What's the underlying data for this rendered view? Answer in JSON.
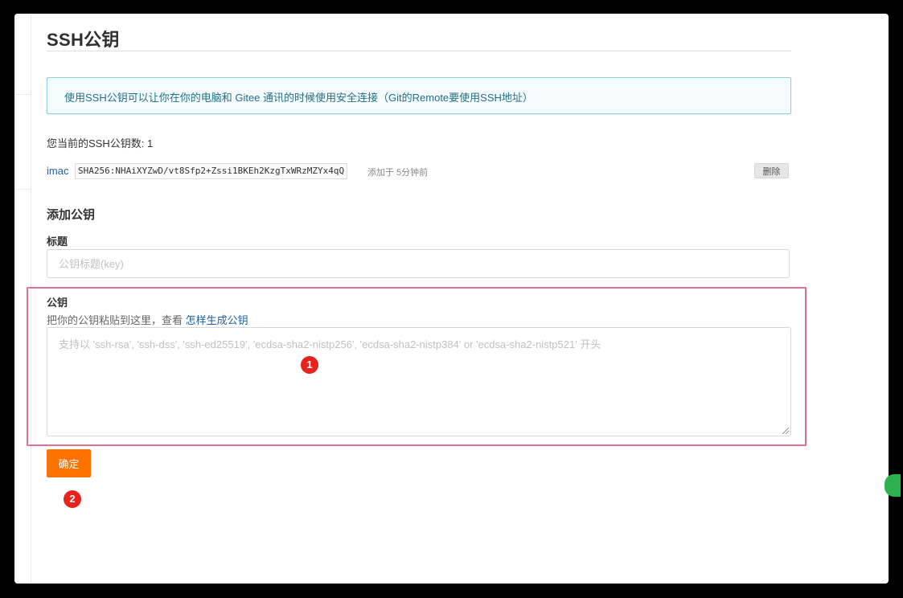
{
  "page": {
    "title": "SSH公钥",
    "info_message": "使用SSH公钥可以让你在你的电脑和 Gitee 通讯的时候使用安全连接（Git的Remote要使用SSH地址）",
    "key_count_text": "您当前的SSH公钥数: 1"
  },
  "keys": [
    {
      "name": "imac",
      "fingerprint": "SHA256:NHAiXYZwD/vt8Sfp2+Zssi1BKEh2KzgTxWRzMZYx4qQ",
      "added": "添加于 5分钟前",
      "delete_label": "删除"
    }
  ],
  "form": {
    "heading": "添加公钥",
    "title_label": "标题",
    "title_placeholder": "公钥标题(key)",
    "key_label": "公钥",
    "key_help": "把你的公钥粘贴到这里，查看 ",
    "key_help_link": "怎样生成公钥",
    "key_placeholder": "支持以 'ssh-rsa', 'ssh-dss', 'ssh-ed25519', 'ecdsa-sha2-nistp256', 'ecdsa-sha2-nistp384' or 'ecdsa-sha2-nistp521' 开头",
    "submit_label": "确定"
  },
  "annotations": {
    "marker_1": "1",
    "marker_2": "2",
    "highlight_color": "#df6e9a",
    "marker_color": "#e8231b"
  },
  "colors": {
    "accent": "#fe7300",
    "link": "#1e5f9a",
    "info_bg": "#f3fbfc",
    "info_border": "#8fd0dc"
  }
}
